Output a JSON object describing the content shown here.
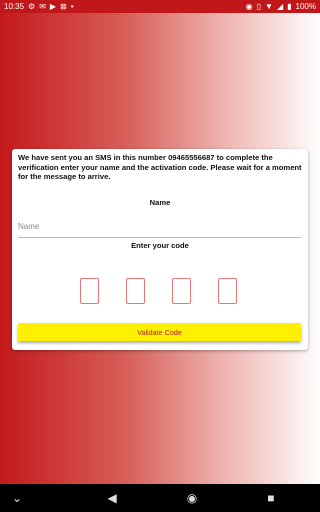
{
  "status_bar": {
    "time": "10:35",
    "battery": "100%",
    "left_icons": [
      "settings-icon",
      "mail-icon",
      "youtube-icon",
      "no-sim-icon",
      "dot-icon"
    ],
    "right_icons": [
      "location-icon",
      "vibrate-icon",
      "wifi-icon",
      "signal-icon",
      "battery-icon"
    ]
  },
  "verification": {
    "message": "We have sent you an SMS in this number 09465556687 to complete the verification enter your name and the activation code. Please wait for a moment for the message to arrive.",
    "name_label": "Name",
    "name_placeholder": "Name",
    "name_value": "",
    "code_label": "Enter your code",
    "code_digits": [
      "",
      "",
      "",
      ""
    ],
    "validate_button": "Validate Code"
  },
  "nav_bar": {
    "buttons": [
      "chevron-down-icon",
      "back-icon",
      "home-icon",
      "recents-icon"
    ]
  },
  "colors": {
    "primary_red": "#c4191b",
    "button_yellow": "#ffef00",
    "button_text": "#b22222",
    "code_box_border": "#e8777a"
  }
}
